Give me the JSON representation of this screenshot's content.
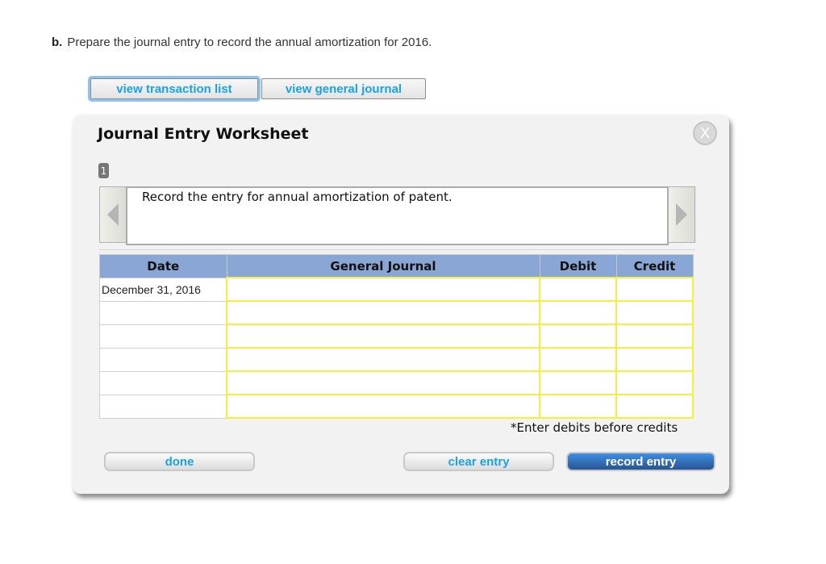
{
  "question": {
    "label": "b.",
    "text": "Prepare the journal entry to record the annual amortization for 2016."
  },
  "top_buttons": {
    "transaction_list": "view transaction list",
    "general_journal": "view general journal"
  },
  "worksheet": {
    "title": "Journal Entry Worksheet",
    "close_icon": "X",
    "step_number": "1",
    "instruction": "Record the entry for annual amortization of patent.",
    "table": {
      "headers": [
        "Date",
        "General Journal",
        "Debit",
        "Credit"
      ],
      "rows": [
        {
          "date": "December 31, 2016",
          "account": "",
          "debit": "",
          "credit": ""
        },
        {
          "date": "",
          "account": "",
          "debit": "",
          "credit": ""
        },
        {
          "date": "",
          "account": "",
          "debit": "",
          "credit": ""
        },
        {
          "date": "",
          "account": "",
          "debit": "",
          "credit": ""
        },
        {
          "date": "",
          "account": "",
          "debit": "",
          "credit": ""
        },
        {
          "date": "",
          "account": "",
          "debit": "",
          "credit": ""
        }
      ]
    },
    "note": "*Enter debits before credits",
    "buttons": {
      "done": "done",
      "clear": "clear entry",
      "record": "record entry"
    }
  },
  "colors": {
    "link_blue": "#1aa2e6",
    "header_blue": "#8aa6d4",
    "input_border_yellow": "#f4ee42",
    "record_button": "#2a5492"
  }
}
